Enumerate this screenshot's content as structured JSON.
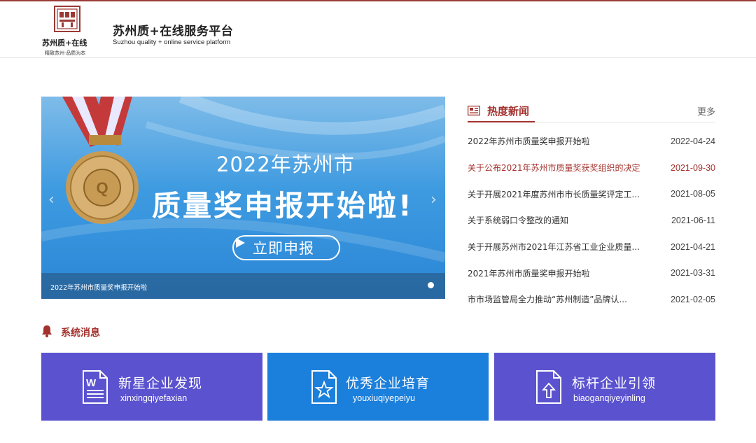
{
  "header": {
    "title": "苏州质+在线服务平台",
    "subtitle": "Suzhou quality + online service platform",
    "logo_text_main": "苏州质+在线",
    "logo_slogan": "精致苏州·品质为本"
  },
  "banner": {
    "headline_1": "2022年苏州市",
    "headline_2": "质量奖申报开始啦!",
    "button_label": "立即申报",
    "caption": "2022年苏州市质量奖申报开始啦",
    "colors": {
      "bg_top": "#7fbce9",
      "bg_bottom": "#2a86d6",
      "medal": "#c89b55"
    }
  },
  "news": {
    "title": "热度新闻",
    "more_label": "更多",
    "items": [
      {
        "title": "2022年苏州市质量奖申报开始啦",
        "date": "2022-04-24"
      },
      {
        "title": "关于公布2021年苏州市质量奖获奖组织的决定",
        "date": "2021-09-30"
      },
      {
        "title": "关于开展2021年度苏州市市长质量奖评定工...",
        "date": "2021-08-05"
      },
      {
        "title": "关于系统弱口令整改的通知",
        "date": "2021-06-11"
      },
      {
        "title": "关于开展苏州市2021年江苏省工业企业质量...",
        "date": "2021-04-21"
      },
      {
        "title": "2021年苏州市质量奖申报开始啦",
        "date": "2021-03-31"
      },
      {
        "title": "市市场监管局全力推动“苏州制造”品牌认...",
        "date": "2021-02-05"
      }
    ]
  },
  "system": {
    "title": "系统消息"
  },
  "tiles": [
    {
      "label": "新星企业发现",
      "pinyin": "xinxingqiyefaxian",
      "icon": "word-document-icon",
      "color": "#5b52cf"
    },
    {
      "label": "优秀企业培育",
      "pinyin": "youxiuqiyepeiyu",
      "icon": "star-document-icon",
      "color": "#1b7fdc"
    },
    {
      "label": "标杆企业引领",
      "pinyin": "biaoganqiyeyinling",
      "icon": "upload-document-icon",
      "color": "#5b52cf"
    }
  ],
  "colors": {
    "accent": "#a3322d",
    "topline": "#9b3a35"
  }
}
